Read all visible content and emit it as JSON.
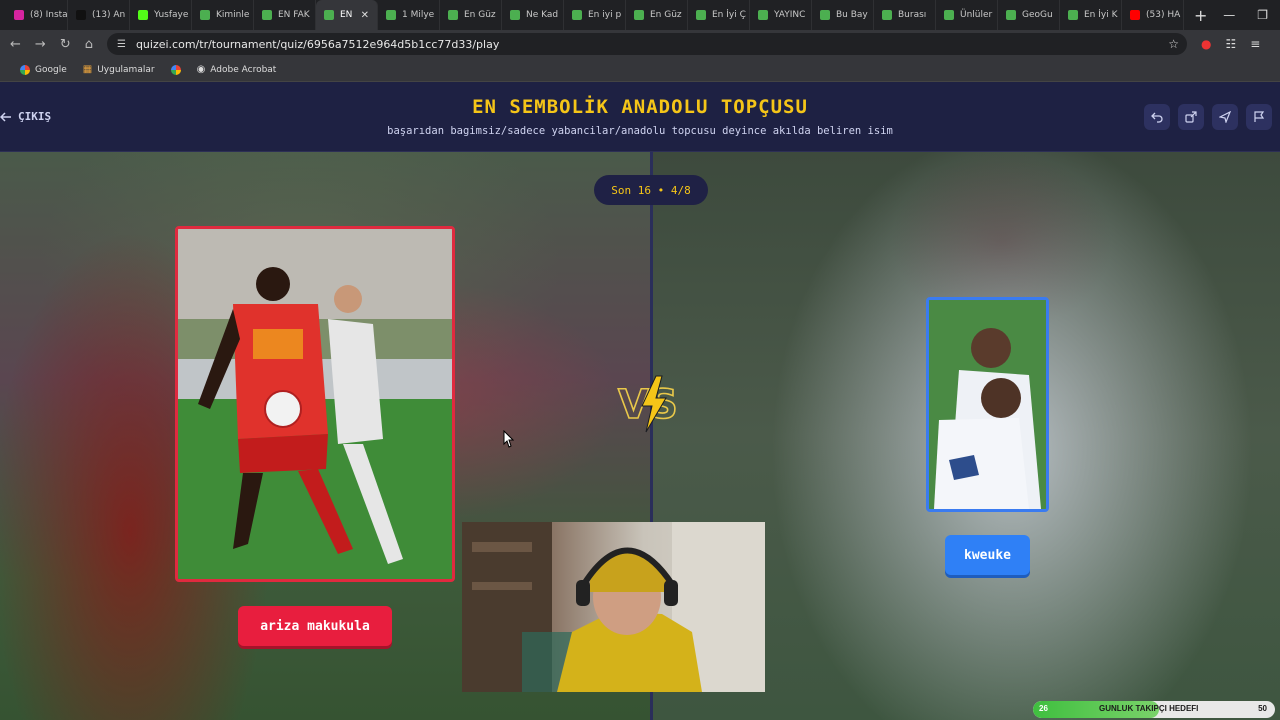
{
  "browser": {
    "tabs": [
      {
        "label": "(8) Insta",
        "color": "#d6249f"
      },
      {
        "label": "(13) An",
        "color": "#111111"
      },
      {
        "label": "Yusfaye",
        "color": "#53fc18"
      },
      {
        "label": "Kiminle",
        "color": "#4caf50"
      },
      {
        "label": "EN FAK",
        "color": "#4caf50"
      },
      {
        "label": "EN",
        "color": "#4caf50",
        "active": true
      },
      {
        "label": "1 Milye",
        "color": "#4caf50"
      },
      {
        "label": "En Güz",
        "color": "#4caf50"
      },
      {
        "label": "Ne Kad",
        "color": "#4caf50"
      },
      {
        "label": "En iyi p",
        "color": "#4caf50"
      },
      {
        "label": "En Güz",
        "color": "#4caf50"
      },
      {
        "label": "En İyi Ç",
        "color": "#4caf50"
      },
      {
        "label": "YAYINC",
        "color": "#4caf50"
      },
      {
        "label": "Bu Bay",
        "color": "#4caf50"
      },
      {
        "label": "Burası",
        "color": "#4caf50"
      },
      {
        "label": "Ünlüler",
        "color": "#4caf50"
      },
      {
        "label": "GeoGu",
        "color": "#4caf50"
      },
      {
        "label": "En İyi K",
        "color": "#4caf50"
      },
      {
        "label": "(53) HA",
        "color": "#ff0000"
      }
    ],
    "url": "quizei.com/tr/tournament/quiz/6956a7512e964d5b1cc77d33/play",
    "bookmarks": [
      "Google",
      "Uygulamalar",
      "Adobe Acrobat"
    ]
  },
  "header": {
    "exit_label": "ÇIKIŞ",
    "title": "EN SEMBOLİK ANADOLU TOPÇUSU",
    "subtitle": "başarıdan bagimsiz/sadece yabancilar/anadolu topcusu deyince akılda beliren isim"
  },
  "round": {
    "label": "Son 16 • 4/8"
  },
  "left_choice": {
    "name": "ariza makukula",
    "accent": "#e81e3e"
  },
  "right_choice": {
    "name": "kweuke",
    "accent": "#2f80f6"
  },
  "vs_label": "VS",
  "goal_bar": {
    "current": "26",
    "label": "GUNLUK TAKIPÇI HEDEFI",
    "target": "50",
    "progress": 0.52
  },
  "icons": [
    "undo-icon",
    "share-icon",
    "send-icon",
    "flag-icon",
    "back-arrow-icon"
  ]
}
